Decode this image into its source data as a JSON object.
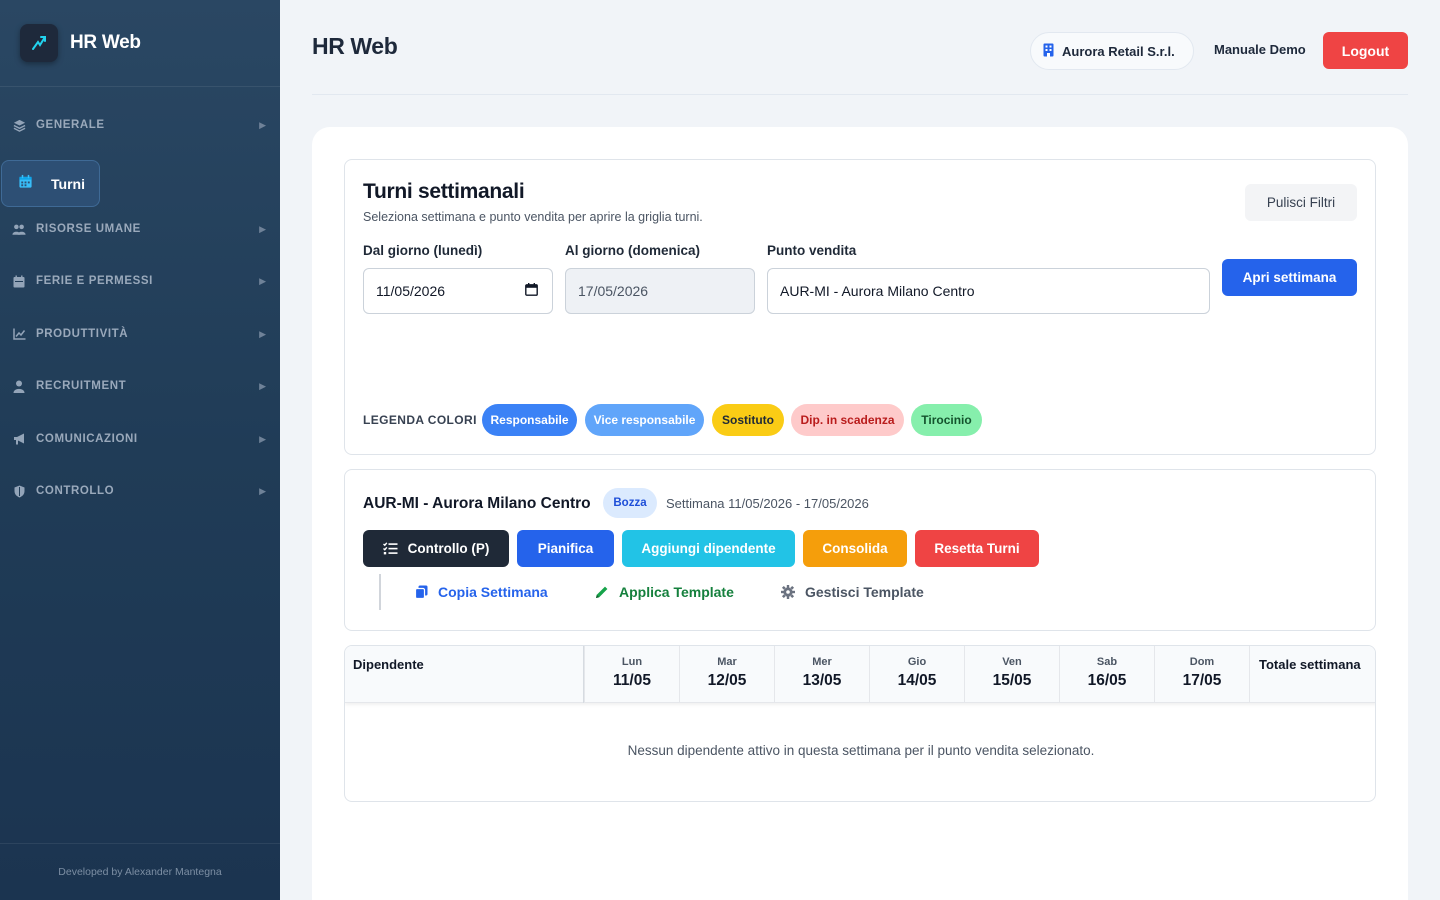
{
  "app": {
    "name": "HR Web"
  },
  "sidebar": {
    "items": [
      {
        "label": "GENERALE",
        "icon": "layers-icon"
      },
      {
        "label": "RISORSE UMANE",
        "icon": "users-icon"
      },
      {
        "label": "FERIE E PERMESSI",
        "icon": "calendar-icon"
      },
      {
        "label": "PRODUTTIVITÀ",
        "icon": "chart-line-icon"
      },
      {
        "label": "RECRUITMENT",
        "icon": "user-icon"
      },
      {
        "label": "COMUNICAZIONI",
        "icon": "megaphone-icon"
      },
      {
        "label": "CONTROLLO",
        "icon": "shield-icon"
      }
    ],
    "active_item": {
      "label": "Turni",
      "icon": "calendar-icon"
    },
    "footer": "Developed by Alexander Mantegna"
  },
  "header": {
    "title": "HR Web",
    "company": "Aurora Retail S.r.l.",
    "manual": "Manuale Demo",
    "logout": "Logout"
  },
  "filters": {
    "title": "Turni settimanali",
    "subtitle": "Seleziona settimana e punto vendita per aprire la griglia turni.",
    "clear_label": "Pulisci Filtri",
    "from_label": "Dal giorno (lunedì)",
    "from_value": "11/05/2026",
    "to_label": "Al giorno (domenica)",
    "to_value": "17/05/2026",
    "store_label": "Punto vendita",
    "store_value": "AUR-MI - Aurora Milano Centro",
    "open_label": "Apri settimana",
    "legend_label": "LEGENDA COLORI",
    "legend": [
      {
        "label": "Responsabile",
        "bg": "#3b82f6",
        "fg": "#ffffff"
      },
      {
        "label": "Vice responsabile",
        "bg": "#60a5fa",
        "fg": "#ffffff"
      },
      {
        "label": "Sostituto",
        "bg": "#facc15",
        "fg": "#1f2937"
      },
      {
        "label": "Dip. in scadenza",
        "bg": "#fecaca",
        "fg": "#b91c1c"
      },
      {
        "label": "Tirocinio",
        "bg": "#86efac",
        "fg": "#14532d"
      }
    ]
  },
  "week": {
    "store_name": "AUR-MI - Aurora Milano Centro",
    "status": "Bozza",
    "range": "Settimana 11/05/2026 - 17/05/2026",
    "actions": {
      "controllo": "Controllo (P)",
      "pianifica": "Pianifica",
      "aggiungi": "Aggiungi dipendente",
      "consolida": "Consolida",
      "resetta": "Resetta Turni"
    },
    "links": {
      "copia": "Copia Settimana",
      "applica": "Applica Template",
      "gestisci": "Gestisci Template"
    }
  },
  "table": {
    "col_employee": "Dipendente",
    "col_total": "Totale settimana",
    "days": [
      {
        "name": "Lun",
        "date": "11/05"
      },
      {
        "name": "Mar",
        "date": "12/05"
      },
      {
        "name": "Mer",
        "date": "13/05"
      },
      {
        "name": "Gio",
        "date": "14/05"
      },
      {
        "name": "Ven",
        "date": "15/05"
      },
      {
        "name": "Sab",
        "date": "16/05"
      },
      {
        "name": "Dom",
        "date": "17/05"
      }
    ],
    "empty_message": "Nessun dipendente attivo in questa settimana per il punto vendita selezionato."
  },
  "colors": {
    "primary": "#2563eb",
    "danger": "#ef4444",
    "info": "#22c3e6",
    "warning": "#f59e0b",
    "dark": "#1f2937",
    "sidebar": "#203c57"
  }
}
